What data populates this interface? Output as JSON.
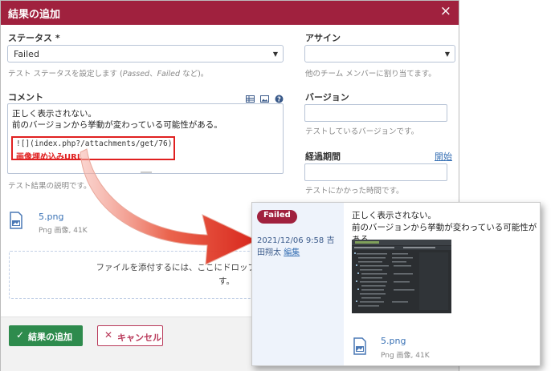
{
  "dialog": {
    "title": "結果の追加",
    "close_icon": "×",
    "status": {
      "label": "ステータス *",
      "value": "Failed",
      "hint_prefix": "テスト ステータスを設定します (",
      "hint_passed": "Passed",
      "hint_sep": "、",
      "hint_failed": "Failed",
      "hint_suffix": " など)。"
    },
    "comment": {
      "label": "コメント",
      "line1": "正しく表示されない。",
      "line2": "前のバージョンから挙動が変わっている可能性がある。",
      "code": "![](index.php?/attachments/get/76)",
      "annotation": "画像埋め込みURL",
      "hint": "テスト結果の説明です。"
    },
    "assign": {
      "label": "アサイン",
      "value": "",
      "hint": "他のチーム メンバーに割り当てます。"
    },
    "version": {
      "label": "バージョン",
      "hint": "テストしているバージョンです。"
    },
    "elapsed": {
      "label": "経過期間",
      "start_link": "開始",
      "hint": "テストにかかった時間です。"
    },
    "attachment": {
      "name": "5.png",
      "meta": "Png 画像, 41K"
    },
    "dropzone": {
      "text": "ファイルを添付するには、ここにドロップするか、クリックして参照",
      "text2": "す。"
    },
    "footer": {
      "add_label": "結果の追加",
      "cancel_label": "キャンセル"
    }
  },
  "preview": {
    "badge": "Failed",
    "date": "2021/12/06 9:58 吉",
    "user": "田翔太",
    "edit_link": "編集",
    "line1": "正しく表示されない。",
    "line2": "前のバージョンから挙動が変わっている可能性がある。",
    "attachment": {
      "name": "5.png",
      "meta": "Png 画像, 41K"
    }
  },
  "colors": {
    "brand": "#a0213e",
    "success": "#2e8b4d",
    "link": "#3a72b5",
    "annotation": "#e02020"
  }
}
